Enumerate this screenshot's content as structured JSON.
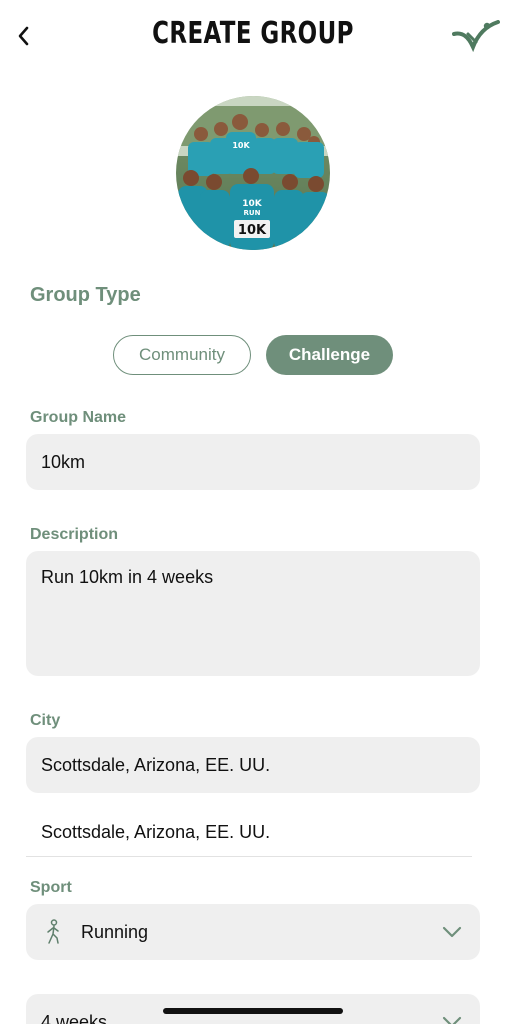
{
  "header": {
    "title": "CREATE GROUP",
    "back_icon": "chevron-left-icon",
    "logo_icon": "check-logo-icon"
  },
  "avatar": {
    "bib_text": "10K",
    "shirt_text": "10K RUN"
  },
  "group_type": {
    "title": "Group Type",
    "options": [
      "Community",
      "Challenge"
    ],
    "selected": "Challenge"
  },
  "group_name": {
    "label": "Group Name",
    "value": "10km"
  },
  "description": {
    "label": "Description",
    "value": "Run 10km in 4 weeks"
  },
  "city": {
    "label": "City",
    "value": "Scottsdale, Arizona, EE. UU.",
    "suggestion": "Scottsdale, Arizona, EE. UU."
  },
  "sport": {
    "label": "Sport",
    "value": "Running",
    "icon": "walking-person-icon"
  },
  "duration": {
    "value": "4 weeks"
  },
  "colors": {
    "accent": "#6f8f7b",
    "field_bg": "#efefef"
  }
}
